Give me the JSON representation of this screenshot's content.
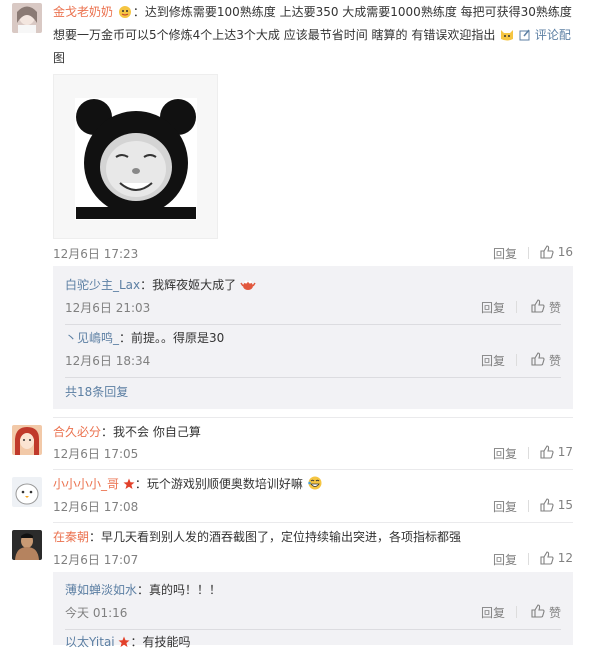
{
  "comments": [
    {
      "name": "金戈老奶奶",
      "text_line1": "：达到修炼需要100熟练度 上达要350 大成需要1000熟练度 每把可获得30熟练度",
      "text_line2": "想要一万金币可以5个修炼4个上达3个大成 应该最节省时间 瞎算的 有错误欢迎指出",
      "comment_link": "评论配",
      "comment_link_wrap": "图",
      "date": "12月6日 17:23",
      "reply": "回复",
      "likes": "16",
      "replies": [
        {
          "name": "白驼少主_Lax",
          "text": "：我辉夜姬大成了",
          "date": "12月6日 21:03",
          "reply": "回复",
          "like": "赞"
        },
        {
          "name": "丶见嶋鸣_",
          "text": "：前提。。得原是30",
          "date": "12月6日 18:34",
          "reply": "回复",
          "like": "赞"
        }
      ],
      "more_replies": "共18条回复"
    },
    {
      "name": "合久必分",
      "text": "：我不会 你自己算",
      "date": "12月6日 17:05",
      "reply": "回复",
      "likes": "17"
    },
    {
      "name": "小小小小_哥",
      "text": "：玩个游戏别顺便奥数培训好嘛",
      "date": "12月6日 17:08",
      "reply": "回复",
      "likes": "15"
    },
    {
      "name": "在秦朝",
      "text": "：早几天看到别人发的酒吞截图了，定位持续输出突进，各项指标都强",
      "date": "12月6日 17:07",
      "reply": "回复",
      "likes": "12",
      "replies": [
        {
          "name": "薄如蝉淡如水",
          "text": "：真的吗！！！",
          "date": "今天 01:16",
          "reply": "回复",
          "like": "赞"
        },
        {
          "name": "以太Yitai",
          "text": "：有技能吗",
          "date": "",
          "reply": "",
          "like": ""
        }
      ]
    }
  ],
  "colors": {
    "link": "#eb7350",
    "blue": "#5c7fa3",
    "gray": "#808080",
    "reply_bg": "#f2f2f5"
  }
}
